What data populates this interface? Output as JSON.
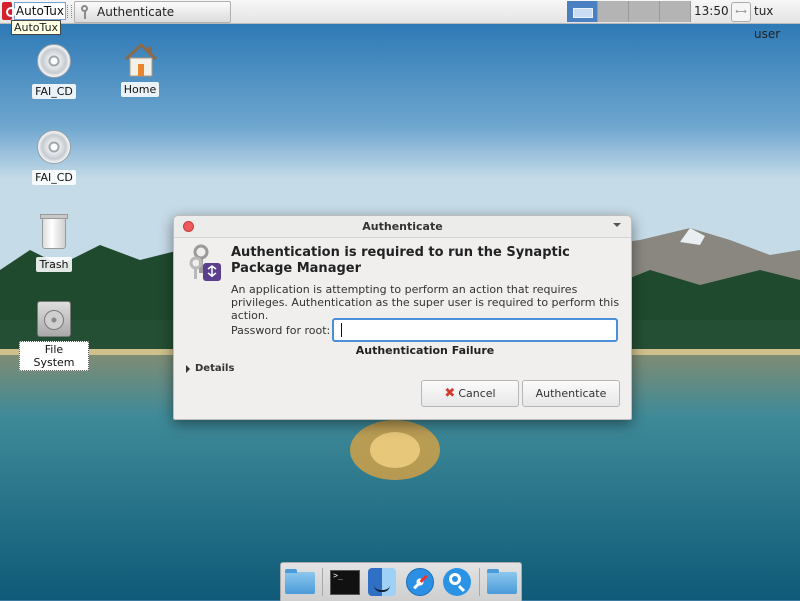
{
  "top_panel": {
    "menu_label": "AutoTux",
    "tooltip": "AutoTux",
    "taskbar": [
      {
        "label": "Authenticate"
      }
    ],
    "clock": "13:50",
    "user": "tux user"
  },
  "desktop": {
    "icons": [
      {
        "label": "FAI_CD",
        "icon": "cd-icon"
      },
      {
        "label": "Home",
        "icon": "home-folder-icon"
      },
      {
        "label": "FAI_CD",
        "icon": "cd-icon"
      },
      {
        "label": "Trash",
        "icon": "trash-icon"
      },
      {
        "label": "File System",
        "icon": "drive-icon"
      }
    ]
  },
  "dialog": {
    "title": "Authenticate",
    "heading": "Authentication is required to run the Synaptic Package Manager",
    "description": "An application is attempting to perform an action that requires privileges. Authentication as the super user is required to perform this action.",
    "password_label": "Password for root:",
    "password_value": "",
    "failure_message": "Authentication Failure",
    "details_label": "Details",
    "cancel_label": "Cancel",
    "authenticate_label": "Authenticate"
  },
  "dock": {
    "items": [
      "folder-icon",
      "terminal-icon",
      "finder-icon",
      "safari-icon",
      "search-icon",
      "folder-icon"
    ]
  },
  "colors": {
    "accent": "#4a90d9",
    "cancel_icon": "#d43a2e",
    "close_button": "#ee5b5b"
  }
}
